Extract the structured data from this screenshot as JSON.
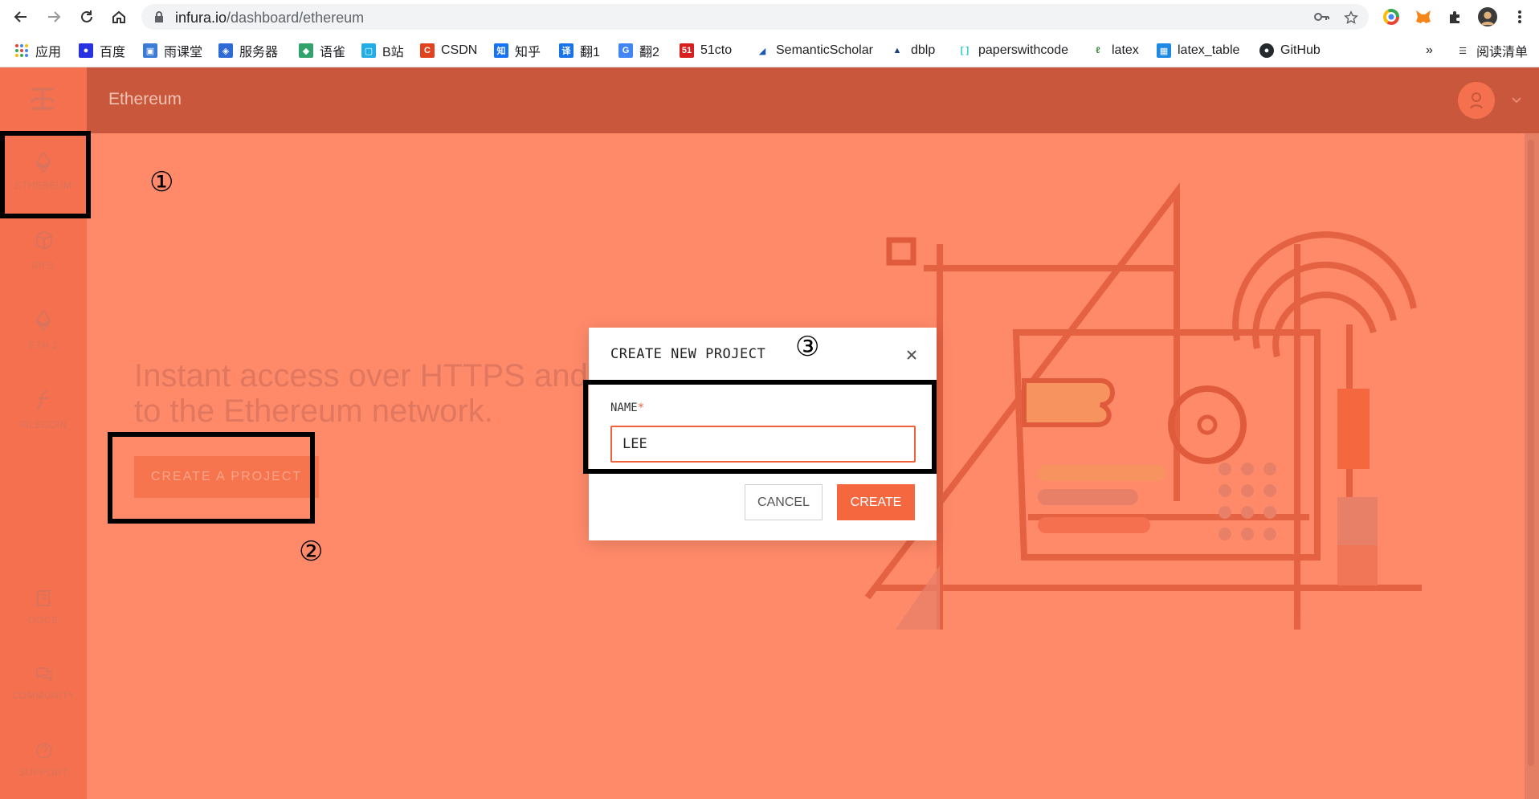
{
  "browser": {
    "url_host": "infura.io",
    "url_path": "/dashboard/ethereum",
    "bookmarks": [
      {
        "label": "应用",
        "color": "#4285f4"
      },
      {
        "label": "百度",
        "color": "#2932e1"
      },
      {
        "label": "雨课堂",
        "color": "#3b7bd6"
      },
      {
        "label": "服务器",
        "color": "#2f6bd6"
      },
      {
        "label": "语雀",
        "color": "#31a36b"
      },
      {
        "label": "B站",
        "color": "#23ade5"
      },
      {
        "label": "CSDN",
        "color": "#e2431f"
      },
      {
        "label": "知乎",
        "color": "#1772f6"
      },
      {
        "label": "翻1",
        "color": "#1a73e8"
      },
      {
        "label": "翻2",
        "color": "#4285f4"
      },
      {
        "label": "51cto",
        "color": "#d7201f"
      },
      {
        "label": "SemanticScholar",
        "color": "#1857b6"
      },
      {
        "label": "dblp",
        "color": "#1a3e8a"
      },
      {
        "label": "paperswithcode",
        "color": "#21cbce"
      },
      {
        "label": "latex",
        "color": "#3d8b3d"
      },
      {
        "label": "latex_table",
        "color": "#1e88e5"
      },
      {
        "label": "GitHub",
        "color": "#24292e"
      }
    ],
    "more_label": "»",
    "reading_list": "阅读清单"
  },
  "app": {
    "header_title": "Ethereum",
    "sidebar": [
      {
        "label": "ETHEREUM",
        "icon": "ethereum-icon"
      },
      {
        "label": "IPFS",
        "icon": "cube-icon"
      },
      {
        "label": "ETH 2",
        "icon": "ethereum-icon"
      },
      {
        "label": "FILECOIN",
        "icon": "filecoin-icon"
      },
      {
        "label": "DOCS",
        "icon": "book-icon"
      },
      {
        "label": "COMMUNITY",
        "icon": "chat-icon"
      },
      {
        "label": "SUPPORT",
        "icon": "help-icon"
      }
    ],
    "hero_line1": "Instant access over HTTPS and",
    "hero_line2": "to the Ethereum network.",
    "create_project_button": "CREATE A PROJECT"
  },
  "modal": {
    "title": "CREATE NEW PROJECT",
    "name_label": "NAME",
    "required_mark": "*",
    "name_value": "LEE",
    "cancel_label": "CANCEL",
    "create_label": "CREATE"
  },
  "annotations": {
    "n1": "①",
    "n2": "②",
    "n3": "③"
  },
  "colors": {
    "overlay": "#ff8a6a",
    "header": "#c9573b",
    "accent": "#f4673f"
  }
}
